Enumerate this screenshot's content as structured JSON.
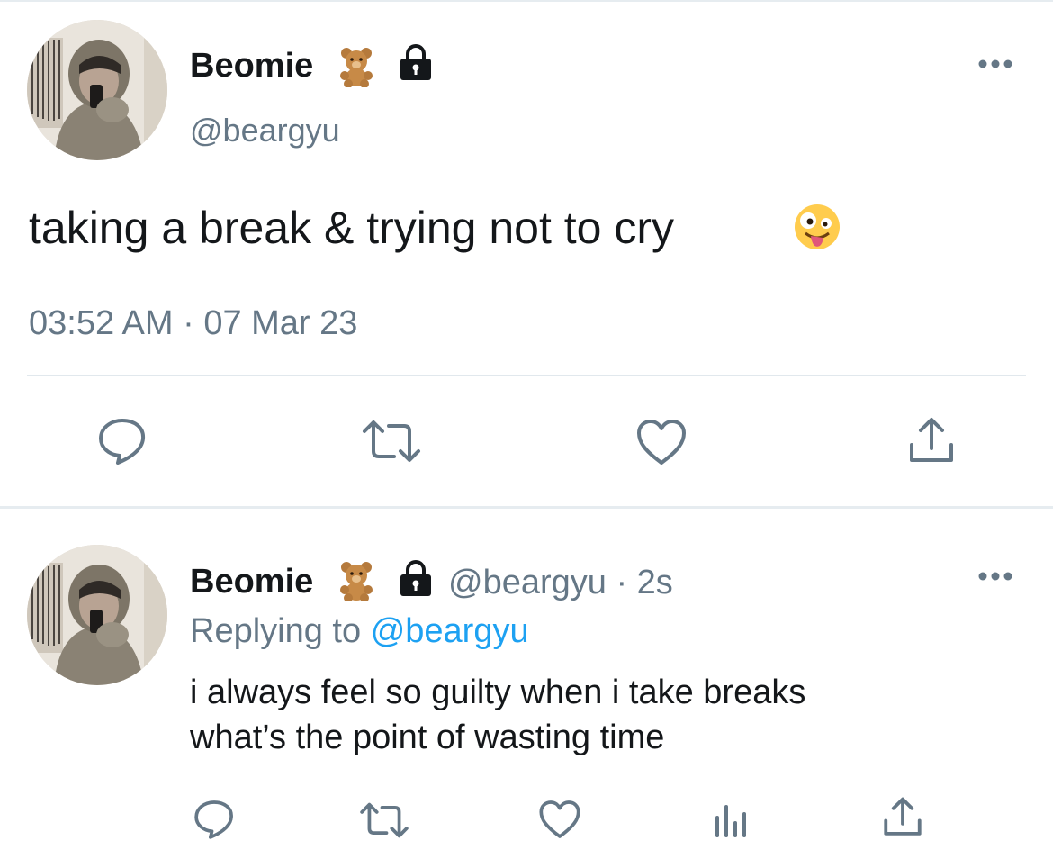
{
  "main_tweet": {
    "display_name": "Beomie",
    "name_emoji": "teddy-bear-emoji",
    "protected_icon": "lock-icon",
    "handle": "@beargyu",
    "text": "taking a break & trying not to cry",
    "text_emoji": "zany-face-emoji",
    "timestamp": "03:52 AM · 07 Mar 23",
    "actions": [
      "reply-icon",
      "retweet-icon",
      "like-icon",
      "share-icon"
    ]
  },
  "reply_tweet": {
    "display_name": "Beomie",
    "name_emoji": "teddy-bear-emoji",
    "protected_icon": "lock-icon",
    "handle_time": "@beargyu · 2s",
    "replying_to_label": "Replying to",
    "replying_to_handle": "@beargyu",
    "text_line1": "i always feel so guilty when i take breaks",
    "text_line2": "what’s the point of wasting time",
    "actions": [
      "reply-icon",
      "retweet-icon",
      "like-icon",
      "analytics-icon",
      "share-icon"
    ]
  },
  "colors": {
    "text_primary": "#14171a",
    "text_secondary": "#657786",
    "link": "#1da1f2",
    "icon": "#657786",
    "divider": "#e1e8ed"
  }
}
